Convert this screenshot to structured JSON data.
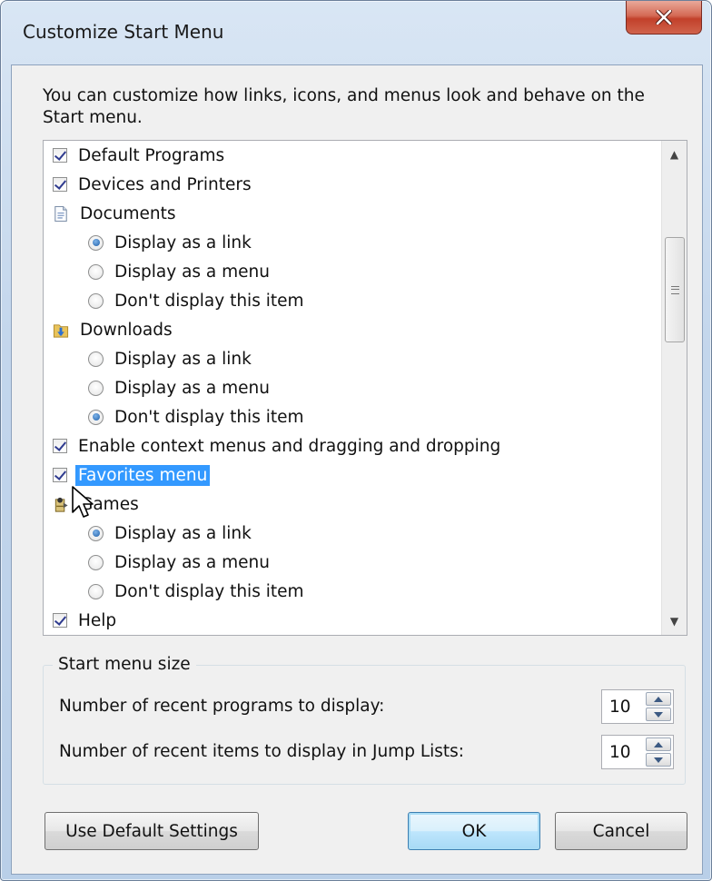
{
  "window": {
    "title": "Customize Start Menu"
  },
  "intro": "You can customize how links, icons, and menus look and behave on the Start menu.",
  "list": {
    "items": [
      {
        "kind": "checkbox",
        "label": "Default Programs",
        "checked": true
      },
      {
        "kind": "checkbox",
        "label": "Devices and Printers",
        "checked": true
      },
      {
        "kind": "header",
        "label": "Documents",
        "icon": "documents-icon"
      },
      {
        "kind": "radio",
        "label": "Display as a link",
        "checked": true
      },
      {
        "kind": "radio",
        "label": "Display as a menu",
        "checked": false
      },
      {
        "kind": "radio",
        "label": "Don't display this item",
        "checked": false
      },
      {
        "kind": "header",
        "label": "Downloads",
        "icon": "downloads-icon"
      },
      {
        "kind": "radio",
        "label": "Display as a link",
        "checked": false
      },
      {
        "kind": "radio",
        "label": "Display as a menu",
        "checked": false
      },
      {
        "kind": "radio",
        "label": "Don't display this item",
        "checked": true
      },
      {
        "kind": "checkbox",
        "label": "Enable context menus and dragging and dropping",
        "checked": true
      },
      {
        "kind": "checkbox",
        "label": "Favorites menu",
        "checked": true,
        "selected": true
      },
      {
        "kind": "header",
        "label": "Games",
        "icon": "games-icon"
      },
      {
        "kind": "radio",
        "label": "Display as a link",
        "checked": true
      },
      {
        "kind": "radio",
        "label": "Display as a menu",
        "checked": false
      },
      {
        "kind": "radio",
        "label": "Don't display this item",
        "checked": false
      },
      {
        "kind": "checkbox",
        "label": "Help",
        "checked": true
      }
    ]
  },
  "size_group": {
    "legend": "Start menu size",
    "recent_programs_label": "Number of recent programs to display:",
    "recent_programs_value": "10",
    "jump_list_label": "Number of recent items to display in Jump Lists:",
    "jump_list_value": "10"
  },
  "buttons": {
    "defaults": "Use Default Settings",
    "ok": "OK",
    "cancel": "Cancel"
  },
  "colors": {
    "selection": "#3399ff",
    "close_button": "#c2402a"
  }
}
